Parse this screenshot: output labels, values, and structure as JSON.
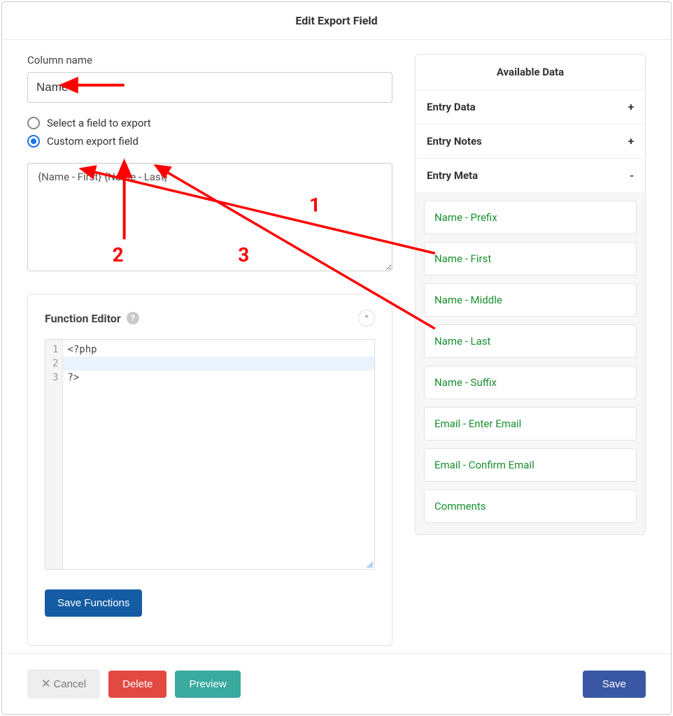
{
  "header": {
    "title": "Edit Export Field"
  },
  "left": {
    "column_label": "Column name",
    "column_value": "Name",
    "radio_select_label": "Select a field to export",
    "radio_custom_label": "Custom export field",
    "custom_value": "{Name - First} {Name - Last}",
    "function_title": "Function Editor",
    "code_lines": [
      "<?php",
      "",
      "?>"
    ],
    "save_functions_label": "Save Functions"
  },
  "right": {
    "panel_title": "Available Data",
    "sections": [
      {
        "title": "Entry Data",
        "symbol": "+",
        "items": []
      },
      {
        "title": "Entry Notes",
        "symbol": "+",
        "items": []
      },
      {
        "title": "Entry Meta",
        "symbol": "-",
        "items": [
          "Name - Prefix",
          "Name - First",
          "Name - Middle",
          "Name - Last",
          "Name - Suffix",
          "Email - Enter Email",
          "Email - Confirm Email",
          "Comments"
        ]
      }
    ]
  },
  "footer": {
    "cancel": "Cancel",
    "delete": "Delete",
    "preview": "Preview",
    "save": "Save"
  },
  "annotations": {
    "labels": [
      "1",
      "2",
      "3"
    ]
  }
}
